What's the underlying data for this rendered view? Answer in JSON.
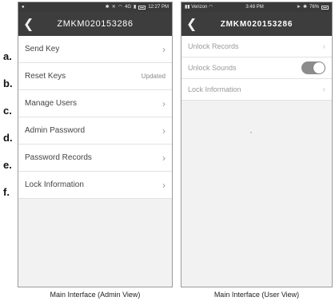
{
  "letters": [
    "a.",
    "b.",
    "c.",
    "d.",
    "e.",
    "f."
  ],
  "admin": {
    "status": {
      "left_icon": "circle-icon",
      "time": "12:27 PM",
      "network": "4G"
    },
    "title": "ZMKM020153286",
    "items": [
      {
        "label": "Send Key",
        "type": "chevron"
      },
      {
        "label": "Reset Keys",
        "type": "status",
        "status": "Updated"
      },
      {
        "label": "Manage Users",
        "type": "chevron"
      },
      {
        "label": "Admin Password",
        "type": "chevron"
      },
      {
        "label": "Password Records",
        "type": "chevron"
      },
      {
        "label": "Lock Information",
        "type": "chevron"
      }
    ],
    "caption": "Main Interface (Admin View)"
  },
  "user": {
    "status": {
      "carrier": "Verizon",
      "time": "3:48 PM",
      "battery": "76%"
    },
    "title": "ZMKM020153286",
    "items": [
      {
        "label": "Unlock Records",
        "type": "chevron"
      },
      {
        "label": "Unlock Sounds",
        "type": "toggle",
        "on": true
      },
      {
        "label": "Lock Information",
        "type": "chevron"
      }
    ],
    "caption": "Main Interface (User View)"
  },
  "colors": {
    "navbar": "#3d3d3d",
    "toggle_on": "#8c8c8c",
    "row_text": "#444444"
  }
}
